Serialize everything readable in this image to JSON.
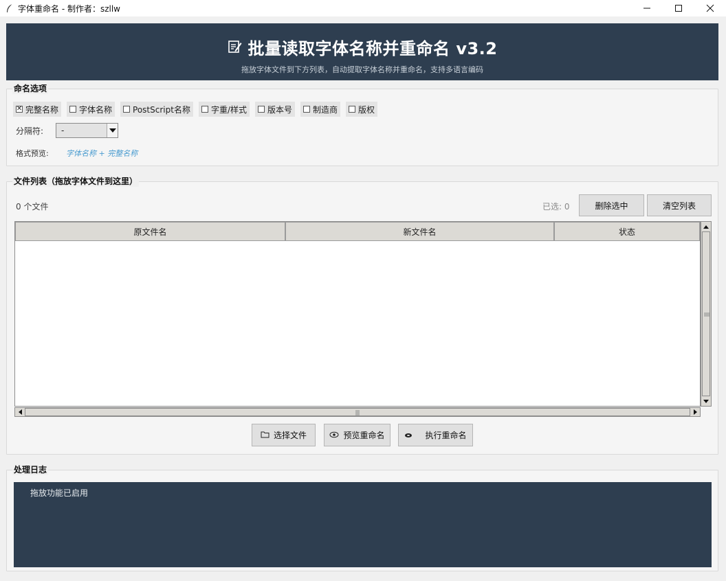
{
  "window": {
    "title": "字体重命名 - 制作者：szllw",
    "app_icon": "feather-icon",
    "controls": [
      "minimize-icon",
      "maximize-icon",
      "close-icon"
    ]
  },
  "banner": {
    "icon": "edit-document-icon",
    "title": "批量读取字体名称并重命名 v3.2",
    "subtitle": "拖放字体文件到下方列表，自动提取字体名称并重命名，支持多语言编码",
    "background": "#2e3e50"
  },
  "naming": {
    "legend": "命名选项",
    "options": [
      {
        "label": "完整名称",
        "checked": true
      },
      {
        "label": "字体名称",
        "checked": false
      },
      {
        "label": "PostScript名称",
        "checked": false
      },
      {
        "label": "字重/样式",
        "checked": false
      },
      {
        "label": "版本号",
        "checked": false
      },
      {
        "label": "制造商",
        "checked": false
      },
      {
        "label": "版权",
        "checked": false
      }
    ],
    "separator_label": "分隔符:",
    "separator_value": "-",
    "preview_label": "格式预览:",
    "preview_value": "字体名称 + 完整名称",
    "preview_color": "#4a9cd0"
  },
  "files": {
    "legend": "文件列表（拖放字体文件到这里）",
    "count_text": "0 个文件",
    "selected_text": "已选: 0",
    "delete_button": "删除选中",
    "clear_button": "清空列表",
    "columns": [
      "原文件名",
      "新文件名",
      "状态"
    ],
    "rows": [],
    "choose_button": "选择文件",
    "preview_button": "预览重命名",
    "execute_button": "执行重命名"
  },
  "log": {
    "legend": "处理日志",
    "lines": [
      "拖放功能已启用"
    ],
    "background": "#2e3e50"
  }
}
